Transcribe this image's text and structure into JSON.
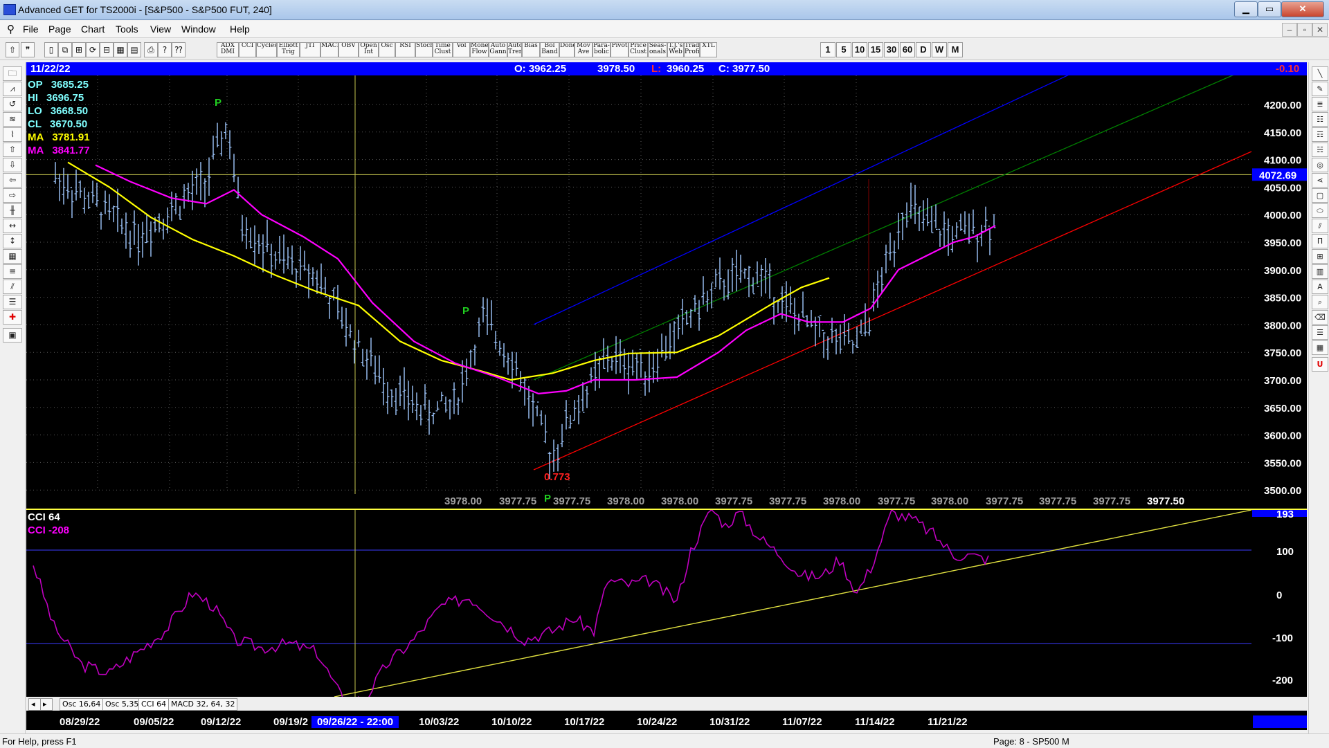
{
  "window": {
    "title": "Advanced GET for TS2000i - [S&P500 - S&P500 FUT, 240]",
    "minimize": "▁",
    "maximize": "▭",
    "close": "✕"
  },
  "menu": {
    "items": [
      "File",
      "Page",
      "Chart",
      "Tools",
      "View",
      "Window",
      "Help"
    ],
    "mdi_minimize": "–",
    "mdi_restore": "▫",
    "mdi_close": "✕"
  },
  "toolbar": {
    "study_buttons": [
      "ADX DMI",
      "CCI",
      "Cycles",
      "Elliott Trig",
      "JTI",
      "MACD",
      "OBV",
      "Open Int",
      "Osc",
      "RSI",
      "Stoch",
      "Time Clust",
      "Vol",
      "Money Flow",
      "Auto Gann",
      "Auto Trend",
      "Bias",
      "Bol Band",
      "Donch",
      "Mov Ave",
      "Para-bolic",
      "Pivot",
      "Price Clust",
      "Seas-onals",
      "T.J.'s Web",
      "Trade Profile",
      "XTL"
    ],
    "periods": [
      "1",
      "5",
      "10",
      "15",
      "30",
      "60",
      "D",
      "W",
      "M"
    ]
  },
  "chart": {
    "header": {
      "date": "11/22/22",
      "open": "O: 3962.25",
      "high": "3978.50",
      "low_label": "L:",
      "low": "3960.25",
      "close": "C: 3977.50",
      "change": "-0.10"
    },
    "info": [
      {
        "label": "OP",
        "value": "3685.25",
        "color": "#80ffff"
      },
      {
        "label": "HI",
        "value": "3696.75",
        "color": "#80ffff"
      },
      {
        "label": "LO",
        "value": "3668.50",
        "color": "#80ffff"
      },
      {
        "label": "CL",
        "value": "3670.50",
        "color": "#80ffff"
      },
      {
        "label": "MA",
        "value": "3781.91",
        "color": "#ffff00"
      },
      {
        "label": "MA",
        "value": "3841.77",
        "color": "#ff00ff"
      }
    ],
    "price_labels": [
      "4200.00",
      "4150.00",
      "4100.00",
      "4050.00",
      "4000.00",
      "3950.00",
      "3900.00",
      "3850.00",
      "3800.00",
      "3750.00",
      "3700.00",
      "3650.00",
      "3600.00",
      "3550.00",
      "3500.00"
    ],
    "current_marker": "4072.69",
    "pivot_letter": "P",
    "ratio_label": "0.773",
    "bottom_values": [
      "3978.00",
      "3977.75",
      "3977.75",
      "3978.00",
      "3978.00",
      "3977.75",
      "3977.75",
      "3978.00",
      "3977.75",
      "3978.00",
      "3977.75",
      "3977.75",
      "3977.75",
      "3977.50"
    ],
    "last_value": "3977.50"
  },
  "cci": {
    "title": "CCI 64",
    "value_line": "CCI  -208",
    "levels": [
      "193",
      "100",
      "0",
      "-100",
      "-200"
    ]
  },
  "tabs": [
    "Osc 16,64",
    "Osc 5,35",
    "CCI 64",
    "MACD 32, 64, 32"
  ],
  "dates": [
    "08/29/22",
    "09/05/22",
    "09/12/22",
    "09/19/2",
    "10/03/22",
    "10/10/22",
    "10/17/22",
    "10/24/22",
    "10/31/22",
    "11/07/22",
    "11/14/22",
    "11/21/22"
  ],
  "date_cursor": "09/26/22 - 22:00",
  "status": {
    "help": "For Help, press F1",
    "page": "Page: 8 - SP500 M"
  },
  "colors": {
    "background": "#000000",
    "header_blue": "#0000ff",
    "ma_fast": "#ffff00",
    "ma_slow": "#ff00ff",
    "channel_top": "#0000ff",
    "channel_mid": "#008000",
    "channel_bottom": "#ff0000",
    "bars": "#a0c8ff",
    "cci_line": "#c000c0"
  }
}
